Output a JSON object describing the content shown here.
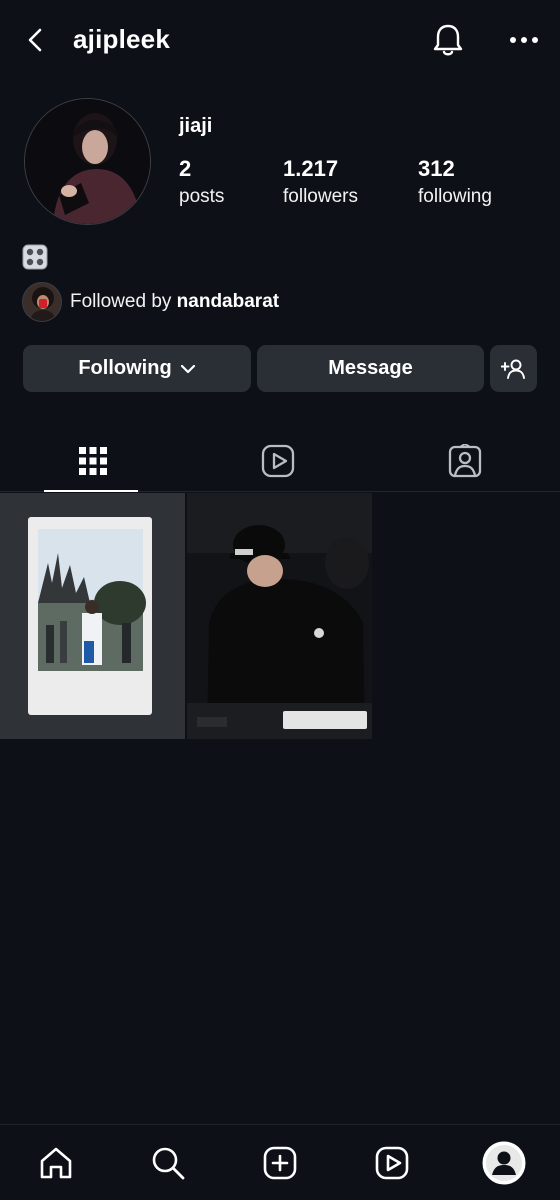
{
  "header": {
    "username": "ajipleek",
    "back_icon": "chevron-left-icon",
    "notifications_icon": "bell-icon",
    "more_icon": "more-horizontal-icon"
  },
  "profile": {
    "display_name": "jiaji",
    "stats": [
      {
        "value": "2",
        "label": "posts"
      },
      {
        "value": "1.217",
        "label": "followers"
      },
      {
        "value": "312",
        "label": "following"
      }
    ],
    "bio_emoji_icon": "game-die-icon",
    "followed_by_prefix": "Followed by ",
    "followed_by_user": "nandabarat"
  },
  "actions": {
    "following_label": "Following",
    "message_label": "Message",
    "add_user_icon": "add-user-icon"
  },
  "tabs": [
    {
      "name": "posts-grid",
      "icon": "grid-icon",
      "selected": true
    },
    {
      "name": "reels",
      "icon": "reels-icon",
      "selected": false
    },
    {
      "name": "tagged",
      "icon": "tagged-icon",
      "selected": false
    }
  ],
  "posts": [
    {
      "name": "post-instax-castle"
    },
    {
      "name": "post-dj-cap"
    }
  ],
  "bottom_nav": [
    "home-icon",
    "search-icon",
    "create-icon",
    "reels-icon",
    "profile-avatar"
  ],
  "colors": {
    "background": "#0d1117",
    "button": "#2a2e35",
    "text": "#ffffff"
  }
}
